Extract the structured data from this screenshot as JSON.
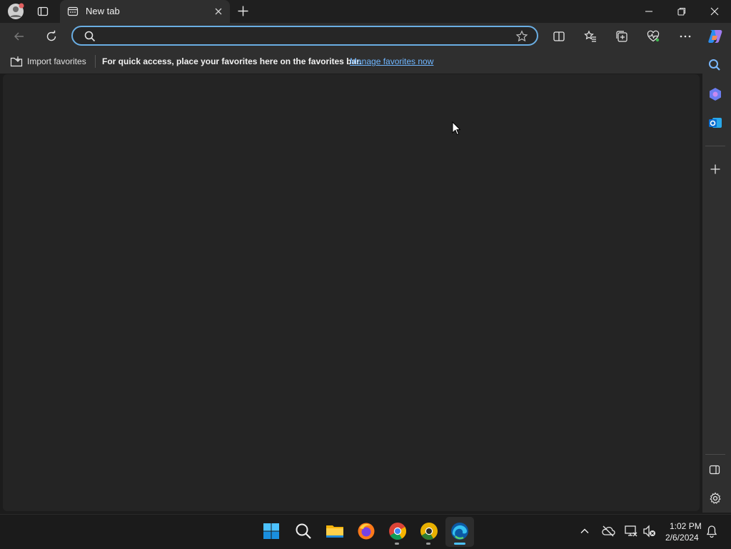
{
  "browser": {
    "tab": {
      "title": "New tab"
    },
    "address_bar": {
      "value": "",
      "placeholder": ""
    },
    "favorites_bar": {
      "import_label": "Import favorites",
      "message": "For quick access, place your favorites here on the favorites bar.",
      "manage_link": "Manage favorites now"
    },
    "accent": "#6aaee3"
  },
  "taskbar": {
    "apps": [
      "start",
      "search",
      "file-explorer",
      "firefox",
      "chrome",
      "chrome-canary",
      "edge"
    ],
    "clock": {
      "time": "1:02 PM",
      "date": "2/6/2024"
    }
  }
}
